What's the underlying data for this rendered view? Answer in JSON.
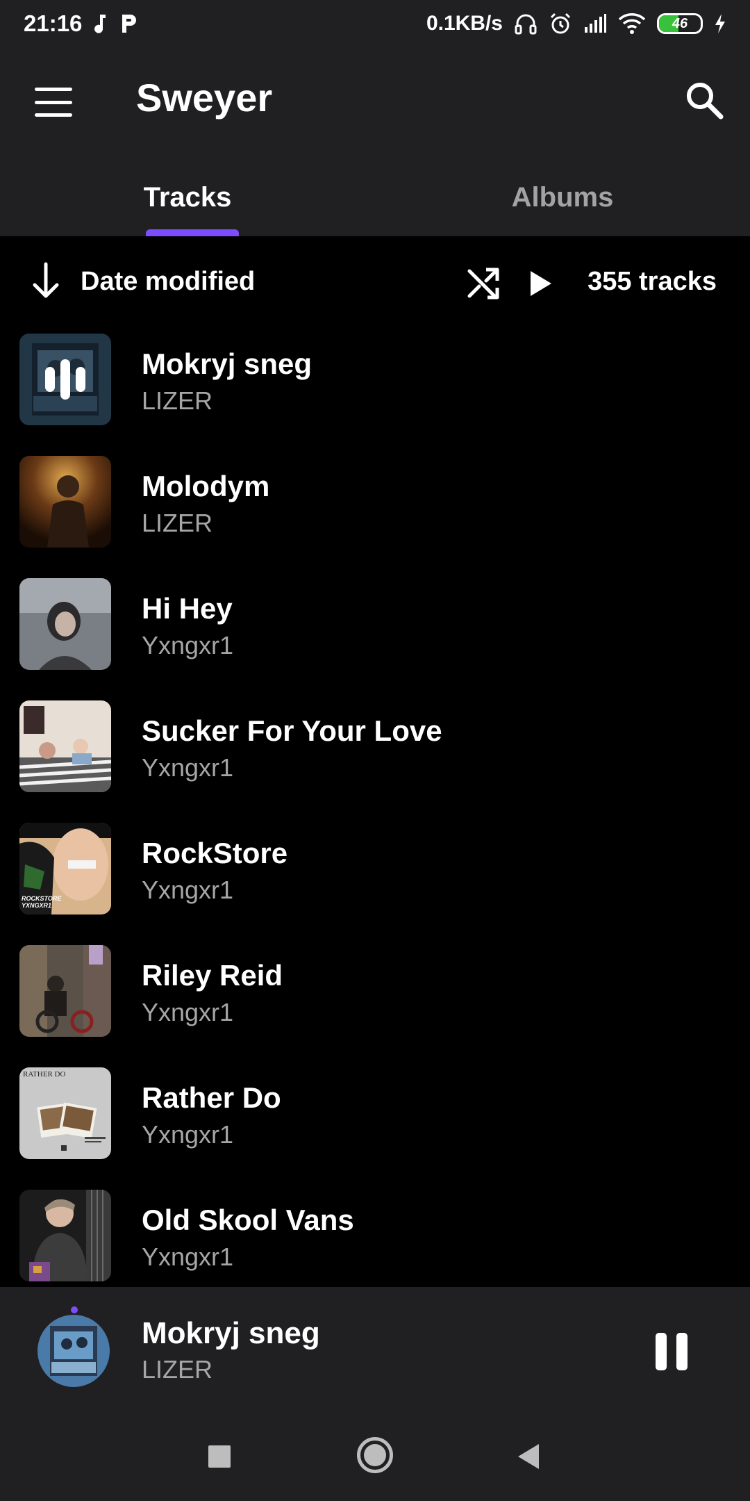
{
  "status_bar": {
    "time": "21:16",
    "net_speed": "0.1KB/s",
    "battery_level": "46",
    "battery_fraction": 0.46,
    "icons": [
      "music-note-icon",
      "p-app-icon",
      "headphones-icon",
      "alarm-icon",
      "signal-icon",
      "wifi-icon",
      "battery-icon",
      "charging-icon"
    ]
  },
  "app_bar": {
    "title": "Sweyer"
  },
  "tabs": [
    {
      "label": "Tracks",
      "active": true
    },
    {
      "label": "Albums",
      "active": false
    }
  ],
  "sort_bar": {
    "sort_label": "Date modified",
    "track_count": "355 tracks"
  },
  "tracks": [
    {
      "title": "Mokryj sneg",
      "artist": "LIZER",
      "playing": true
    },
    {
      "title": "Molodym",
      "artist": "LIZER"
    },
    {
      "title": "Hi Hey",
      "artist": "Yxngxr1"
    },
    {
      "title": "Sucker For Your Love",
      "artist": "Yxngxr1"
    },
    {
      "title": "RockStore",
      "artist": "Yxngxr1"
    },
    {
      "title": "Riley Reid",
      "artist": "Yxngxr1"
    },
    {
      "title": "Rather Do",
      "artist": "Yxngxr1"
    },
    {
      "title": "Old Skool Vans",
      "artist": "Yxngxr1"
    }
  ],
  "art_texts": {
    "rockstore": "ROCKSTORE",
    "rockstore_sub": "YXNGXR1",
    "rather_do": "RATHER DO"
  },
  "mini_player": {
    "title": "Mokryj sneg",
    "artist": "LIZER"
  },
  "colors": {
    "accent": "#7c4dff",
    "surface": "#202022",
    "background": "#000000",
    "secondary_text": "#a6a6a8"
  }
}
